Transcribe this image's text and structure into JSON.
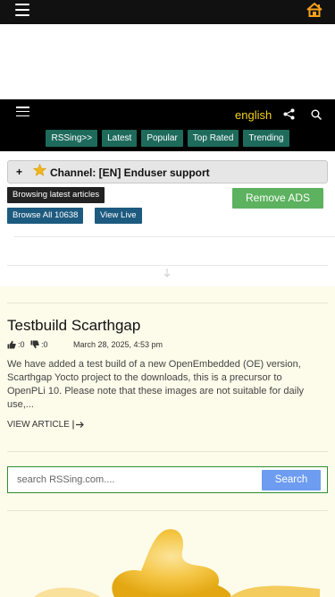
{
  "topbar": {
    "menu_icon": "hamburger-menu-icon",
    "home_icon": "home-icon",
    "accent_color": "#f7a21b"
  },
  "navbar": {
    "language": "english",
    "share_icon": "share-icon",
    "search_icon": "search-icon",
    "tabs": [
      {
        "label": "RSSing>>"
      },
      {
        "label": "Latest"
      },
      {
        "label": "Popular"
      },
      {
        "label": "Top Rated"
      },
      {
        "label": "Trending"
      }
    ],
    "tab_color": "#1e6b5c"
  },
  "channel": {
    "expand_symbol": "+",
    "title": "Channel: [EN] Enduser support",
    "star_icon": "star-icon"
  },
  "actions": {
    "browsing_latest": "Browsing latest articles",
    "browse_all": "Browse All 10638",
    "view_live": "View Live",
    "remove_ads": "Remove ADS"
  },
  "article": {
    "title": "Testbuild Scarthgap",
    "likes": ":0",
    "dislikes": ":0",
    "date": "March 28, 2025, 4:53 pm",
    "excerpt": "We have added a test build of a new OpenEmbedded (OE) version, Scarthgap Yocto project to the downloads, this is a precursor to OpenPLi 10. Please note that these images are not suitable for daily use,...",
    "read_more": "VIEW ARTICLE",
    "background": "#fdfbea"
  },
  "search": {
    "placeholder": "search RSSing.com....",
    "button": "Search",
    "border_color": "#2f8e2f",
    "button_color": "#6d9cf0"
  }
}
